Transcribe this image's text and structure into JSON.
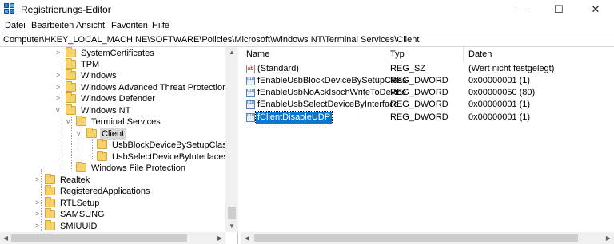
{
  "window": {
    "title": "Registrierungs-Editor",
    "minimize_glyph": "—",
    "maximize_glyph": "☐",
    "close_glyph": "✕"
  },
  "menu": [
    "Datei",
    "Bearbeiten",
    "Ansicht",
    "Favoriten",
    "Hilfe"
  ],
  "address": "Computer\\HKEY_LOCAL_MACHINE\\SOFTWARE\\Policies\\Microsoft\\Windows NT\\Terminal Services\\Client",
  "tree": [
    {
      "label": "SystemCertificates",
      "chevron": ">"
    },
    {
      "label": "TPM",
      "chevron": ""
    },
    {
      "label": "Windows",
      "chevron": ">"
    },
    {
      "label": "Windows Advanced Threat Protection",
      "chevron": ">"
    },
    {
      "label": "Windows Defender",
      "chevron": ">"
    },
    {
      "label": "Windows NT",
      "chevron": "v"
    },
    {
      "label": "Terminal Services",
      "chevron": "v"
    },
    {
      "label": "Client",
      "chevron": "v"
    },
    {
      "label": "UsbBlockDeviceBySetupClasses",
      "chevron": ""
    },
    {
      "label": "UsbSelectDeviceByInterfaces",
      "chevron": ""
    },
    {
      "label": "Windows File Protection",
      "chevron": ""
    },
    {
      "label": "Realtek",
      "chevron": ">"
    },
    {
      "label": "RegisteredApplications",
      "chevron": ""
    },
    {
      "label": "RTLSetup",
      "chevron": ">"
    },
    {
      "label": "SAMSUNG",
      "chevron": ">"
    },
    {
      "label": "SMIUUID",
      "chevron": ">"
    }
  ],
  "columns": {
    "name": "Name",
    "type": "Typ",
    "data": "Daten"
  },
  "values": [
    {
      "name": "(Standard)",
      "type": "REG_SZ",
      "data": "(Wert nicht festgelegt)",
      "icon": "string-value-icon"
    },
    {
      "name": "fEnableUsbBlockDeviceBySetupClass",
      "type": "REG_DWORD",
      "data": "0x00000001 (1)",
      "icon": "dword-value-icon"
    },
    {
      "name": "fEnableUsbNoAckIsochWriteToDevice",
      "type": "REG_DWORD",
      "data": "0x00000050 (80)",
      "icon": "dword-value-icon"
    },
    {
      "name": "fEnableUsbSelectDeviceByInterface",
      "type": "REG_DWORD",
      "data": "0x00000001 (1)",
      "icon": "dword-value-icon"
    },
    {
      "name": "fClientDisableUDP",
      "type": "REG_DWORD",
      "data": "0x00000001 (1)",
      "icon": "dword-value-icon"
    }
  ],
  "colors": {
    "selection": "#0078d7",
    "folder": "#f5d26a"
  }
}
